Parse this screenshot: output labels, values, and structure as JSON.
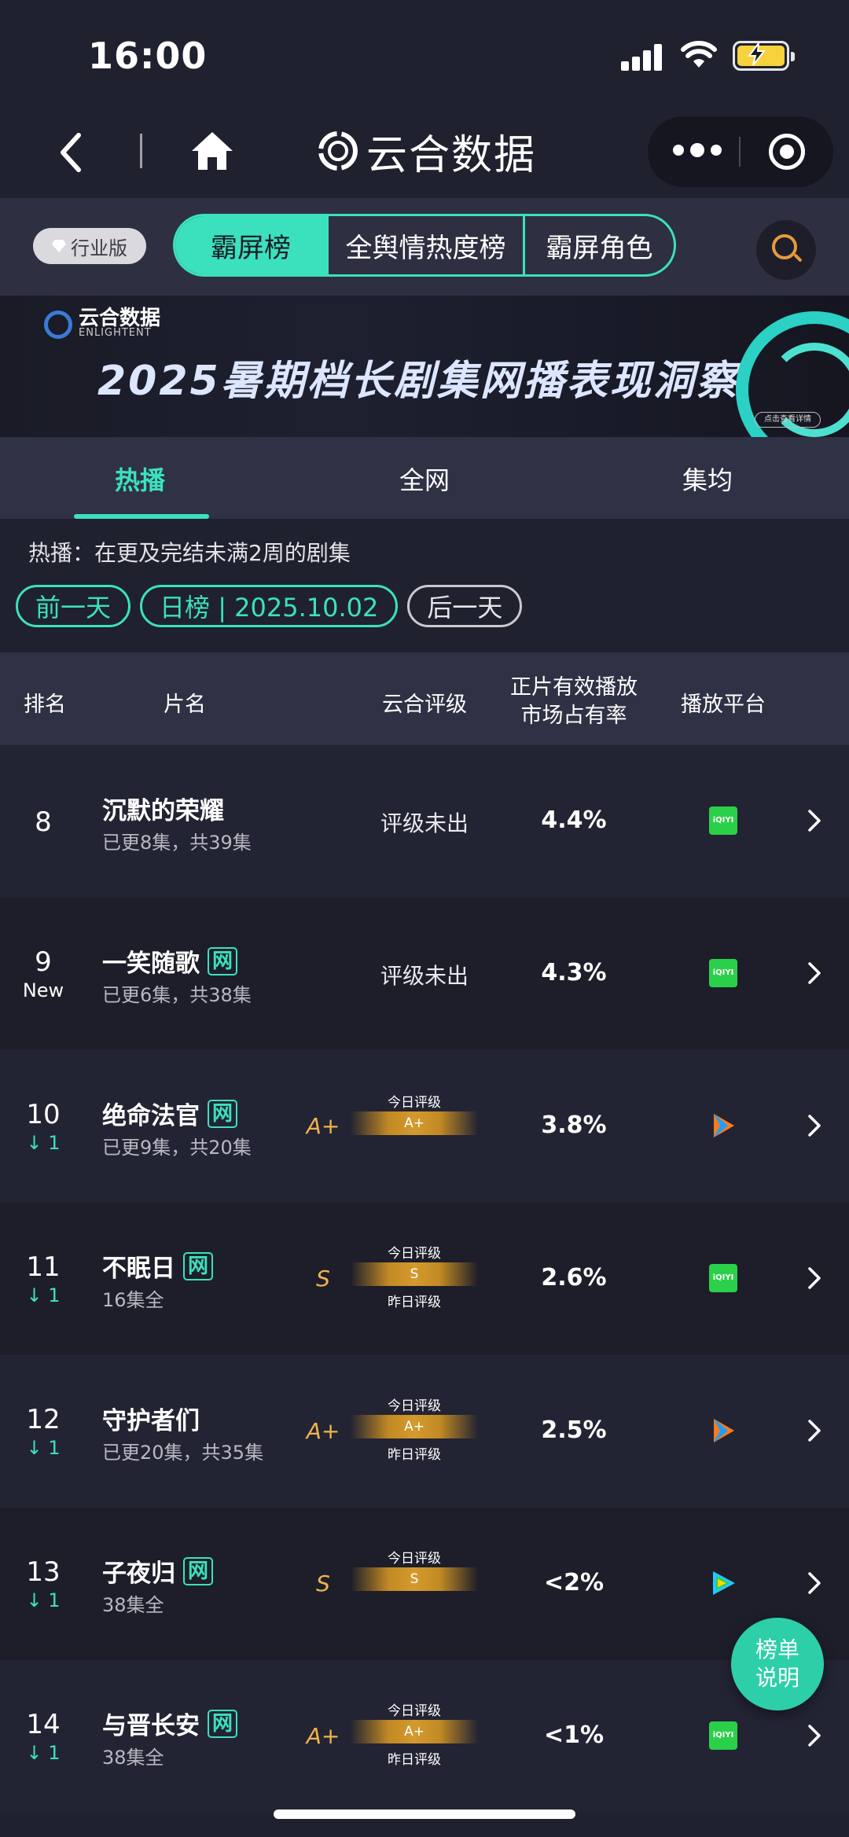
{
  "status_bar": {
    "time": "16:00"
  },
  "header": {
    "title": "云合数据"
  },
  "tabbar": {
    "badge": "行业版",
    "segments": [
      "霸屏榜",
      "全舆情热度榜",
      "霸屏角色"
    ]
  },
  "banner": {
    "logo_name": "云合数据",
    "logo_sub": "ENLIGHTENT",
    "headline": "2025暑期档长剧集网播表现洞察",
    "pill": "点击查看详情"
  },
  "subtabs": [
    "热播",
    "全网",
    "集均"
  ],
  "description": "热播：在更及完结未满2周的剧集",
  "date_controls": {
    "prev": "前一天",
    "current": "日榜 | 2025.10.02",
    "next": "后一天"
  },
  "table_header": {
    "rank": "排名",
    "title": "片名",
    "grade": "云合评级",
    "share_line1": "正片有效播放",
    "share_line2": "市场占有率",
    "platform": "播放平台"
  },
  "grade_labels": {
    "today": "今日评级",
    "yesterday": "昨日评级"
  },
  "rows": [
    {
      "rank": "8",
      "change": "",
      "title": "沉默的荣耀",
      "tag": "",
      "episodes": "已更8集，共39集",
      "grade_text": "评级未出",
      "grade": "",
      "grade_bar": "",
      "share": "4.4%",
      "platform": "iqiyi"
    },
    {
      "rank": "9",
      "change": "New",
      "title": "一笑随歌",
      "tag": "网",
      "episodes": "已更6集，共38集",
      "grade_text": "评级未出",
      "grade": "",
      "grade_bar": "",
      "share": "4.3%",
      "platform": "iqiyi"
    },
    {
      "rank": "10",
      "change": "↓ 1",
      "title": "绝命法官",
      "tag": "网",
      "episodes": "已更9集，共20集",
      "grade_text": "",
      "grade": "A+",
      "grade_bar": "A+",
      "share": "3.8%",
      "platform": "tencent"
    },
    {
      "rank": "11",
      "change": "↓ 1",
      "title": "不眠日",
      "tag": "网",
      "episodes": "16集全",
      "grade_text": "",
      "grade": "S",
      "grade_bar": "S",
      "share": "2.6%",
      "platform": "iqiyi"
    },
    {
      "rank": "12",
      "change": "↓ 1",
      "title": "守护者们",
      "tag": "",
      "episodes": "已更20集，共35集",
      "grade_text": "",
      "grade": "A+",
      "grade_bar": "A+",
      "share": "2.5%",
      "platform": "tencent"
    },
    {
      "rank": "13",
      "change": "↓ 1",
      "title": "子夜归",
      "tag": "网",
      "episodes": "38集全",
      "grade_text": "",
      "grade": "S",
      "grade_bar": "S",
      "share": "<2%",
      "platform": "youku"
    },
    {
      "rank": "14",
      "change": "↓ 1",
      "title": "与晋长安",
      "tag": "网",
      "episodes": "38集全",
      "grade_text": "",
      "grade": "A+",
      "grade_bar": "A+",
      "share": "<1%",
      "platform": "iqiyi"
    }
  ],
  "iqiyi_label": "iQIYI",
  "fab": {
    "line1": "榜单",
    "line2": "说明"
  },
  "colors": {
    "accent": "#3be1bd",
    "grade": "#f2b24c",
    "background": "#20212e"
  }
}
